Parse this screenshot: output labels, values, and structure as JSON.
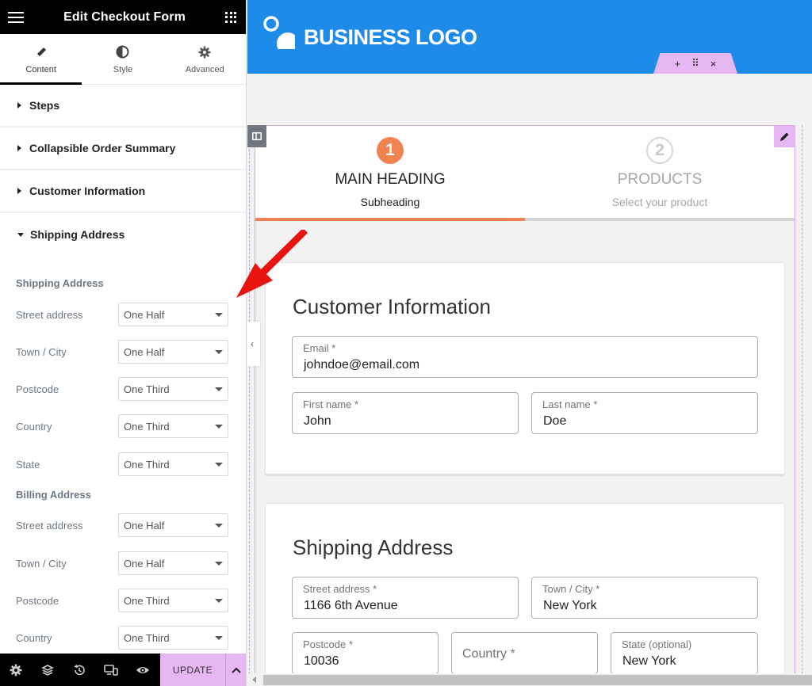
{
  "editor": {
    "title": "Edit Checkout Form",
    "tabs": [
      {
        "label": "Content",
        "icon": "pencil-icon"
      },
      {
        "label": "Style",
        "icon": "half-circle-icon"
      },
      {
        "label": "Advanced",
        "icon": "gear-icon"
      }
    ],
    "sections": [
      {
        "label": "Steps"
      },
      {
        "label": "Collapsible Order Summary"
      },
      {
        "label": "Customer Information"
      },
      {
        "label": "Shipping Address"
      }
    ],
    "shipping_heading": "Shipping Address",
    "shipping_controls": [
      {
        "label": "Street address",
        "value": "One Half"
      },
      {
        "label": "Town / City",
        "value": "One Half"
      },
      {
        "label": "Postcode",
        "value": "One Third"
      },
      {
        "label": "Country",
        "value": "One Third"
      },
      {
        "label": "State",
        "value": "One Third"
      }
    ],
    "billing_heading": "Billing Address",
    "billing_controls": [
      {
        "label": "Street address",
        "value": "One Half"
      },
      {
        "label": "Town / City",
        "value": "One Half"
      },
      {
        "label": "Postcode",
        "value": "One Third"
      },
      {
        "label": "Country",
        "value": "One Third"
      }
    ],
    "footer": {
      "update_label": "UPDATE",
      "icons": [
        "gear-icon",
        "layers-icon",
        "history-icon",
        "responsive-icon",
        "eye-icon"
      ]
    }
  },
  "site": {
    "logo_text": "BUSINESS LOGO",
    "header_tools": [
      "+",
      "⠿",
      "×"
    ],
    "header_color": "#1f8be8",
    "accent": "#f08352",
    "editor_highlight": "#e7b7f3"
  },
  "checkout": {
    "steps": [
      {
        "number": "1",
        "heading": "MAIN HEADING",
        "subheading": "Subheading",
        "active": true
      },
      {
        "number": "2",
        "heading": "PRODUCTS",
        "subheading": "Select your product",
        "active": false
      }
    ],
    "customer": {
      "title": "Customer Information",
      "email": {
        "label": "Email *",
        "value": "johndoe@email.com"
      },
      "first_name": {
        "label": "First name *",
        "value": "John"
      },
      "last_name": {
        "label": "Last name *",
        "value": "Doe"
      }
    },
    "shipping": {
      "title": "Shipping Address",
      "street": {
        "label": "Street address *",
        "value": "1166 6th Avenue"
      },
      "city": {
        "label": "Town / City *",
        "value": "New York"
      },
      "postcode": {
        "label": "Postcode *",
        "value": "10036"
      },
      "country": {
        "placeholder": "Country *"
      },
      "state": {
        "label": "State (optional)",
        "value": "New York"
      }
    }
  }
}
